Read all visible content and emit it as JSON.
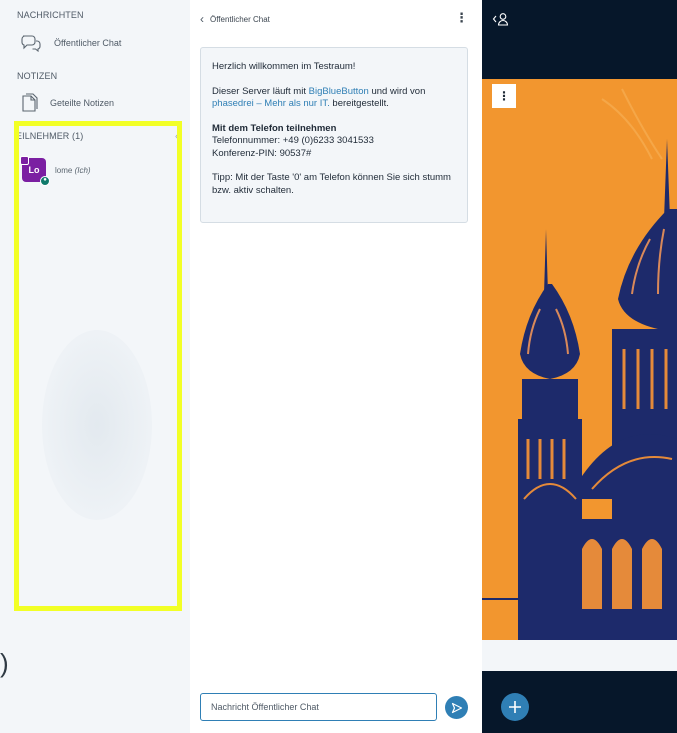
{
  "userlist": {
    "messages_title": "NACHRICHTEN",
    "public_chat_label": "Öffentlicher Chat",
    "notes_title": "NOTIZEN",
    "shared_notes_label": "Geteilte Notizen",
    "participants_title": "EILNEHMER (1)",
    "user": {
      "initials": "Lo",
      "name": "lome",
      "you_tag": "(Ich)"
    }
  },
  "chat": {
    "title": "Öffentlicher Chat",
    "welcome": {
      "heading": "Herzlich willkommen im Testraum!",
      "line1_pre": "Dieser Server läuft mit ",
      "line1_link": "BigBlueButton",
      "line1_mid": " und wird von ",
      "line1_link2": "phasedrei – Mehr als nur IT.",
      "line1_post": " bereitgestellt.",
      "phone_heading": "Mit dem Telefon teilnehmen",
      "phone_number": "Telefonnummer: +49 (0)6233 3041533",
      "conference_pin": "Konferenz-PIN: 90537#",
      "tip": "Tipp: Mit der Taste '0' am Telefon können Sie sich stumm bzw. aktiv schalten."
    },
    "input_placeholder": "Nachricht Öffentlicher Chat"
  },
  "colors": {
    "accent": "#2f7fb5",
    "highlight": "#f2ff26",
    "slide_orange": "#f2962f",
    "slide_navy": "#1d2a6b",
    "avatar": "#7b1fa2",
    "nav_dark": "#06172a"
  }
}
